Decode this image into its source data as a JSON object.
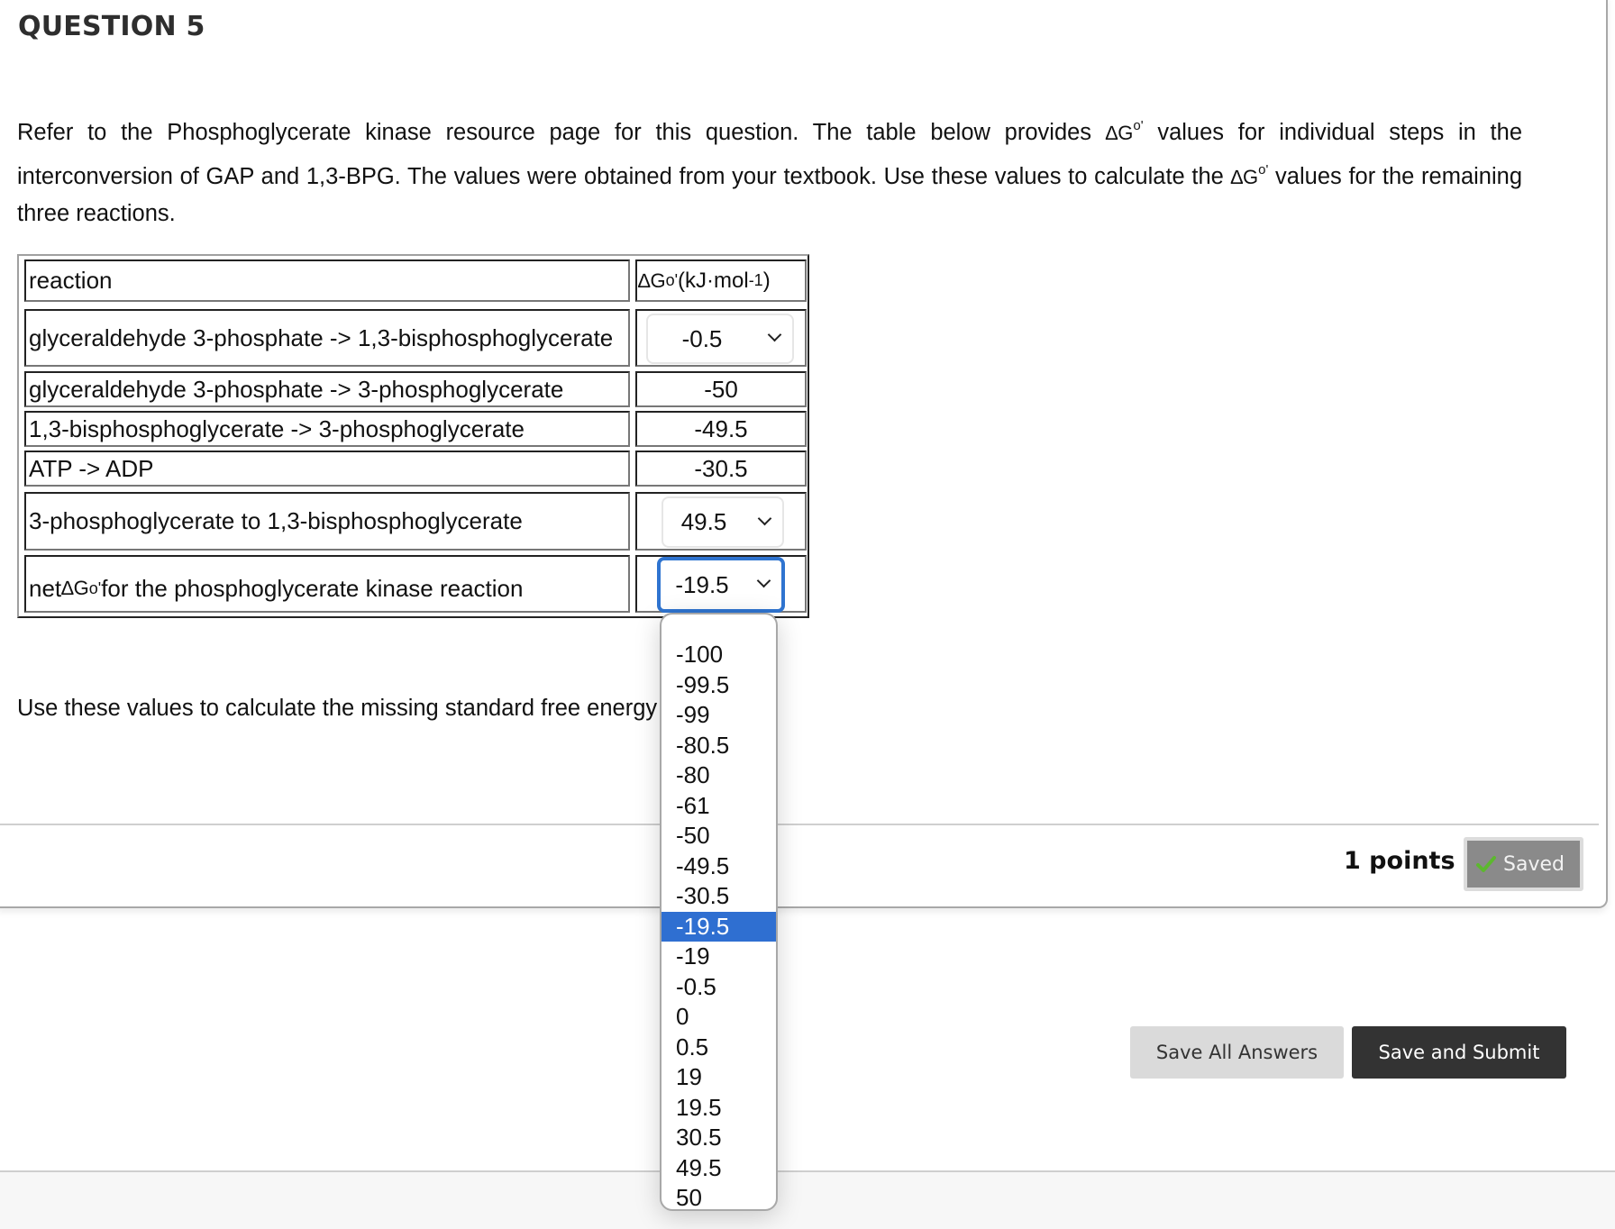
{
  "question": {
    "title": "QUESTION 5",
    "text_part1": "Refer to the Phosphoglycerate kinase resource page for this question. The table below provides ",
    "text_delta": "∆G",
    "text_sup": "o'",
    "text_part2": " values for individual steps in the interconversion of GAP and 1,3-BPG. The values were obtained from your textbook. Use these values to calculate the ",
    "text_delta2": "∆G",
    "text_sup2": "o'",
    "text_part3": " values for the remaining three reactions.",
    "instruction": "Use these values to calculate the missing standard free energy changes."
  },
  "table": {
    "header_reaction": "reaction",
    "header_dg_delta": "∆G",
    "header_dg_sup": "o'",
    "header_dg_units": " (kJ·mol",
    "header_dg_units_sup": "-1",
    "header_dg_close": ")",
    "rows": [
      {
        "reaction": "glyceraldehyde 3-phosphate -> 1,3-bisphosphoglycerate",
        "value": "-0.5",
        "type": "select"
      },
      {
        "reaction": "glyceraldehyde 3-phosphate -> 3-phosphoglycerate",
        "value": "-50",
        "type": "static"
      },
      {
        "reaction": "1,3-bisphosphoglycerate -> 3-phosphoglycerate",
        "value": "-49.5",
        "type": "static"
      },
      {
        "reaction": "ATP -> ADP",
        "value": "-30.5",
        "type": "static"
      },
      {
        "reaction": "3-phosphoglycerate to 1,3-bisphosphoglycerate",
        "value": "49.5",
        "type": "select"
      },
      {
        "reaction_prefix": "net ",
        "reaction_delta": "∆G",
        "reaction_sup": "o'",
        "reaction_suffix": " for the phosphoglycerate kinase reaction",
        "value": "-19.5",
        "type": "select",
        "focused": true
      }
    ]
  },
  "dropdown": {
    "options": [
      "-100",
      "-99.5",
      "-99",
      "-80.5",
      "-80",
      "-61",
      "-50",
      "-49.5",
      "-30.5",
      "-19.5",
      "-19",
      "-0.5",
      "0",
      "0.5",
      "19",
      "19.5",
      "30.5",
      "49.5",
      "50"
    ],
    "selected": "-19.5"
  },
  "status": {
    "points": "1 points",
    "saved_label": "Saved",
    "saved_icon": "checkmark-icon"
  },
  "actions": {
    "save_all": "Save All Answers",
    "save_submit": "Save and Submit"
  },
  "colors": {
    "focus_blue": "#2f74d0",
    "selected_option": "#2f6fd1",
    "saved_bg": "#8a8a8a",
    "submit_bg": "#333333",
    "check_green": "#5cb82e"
  }
}
